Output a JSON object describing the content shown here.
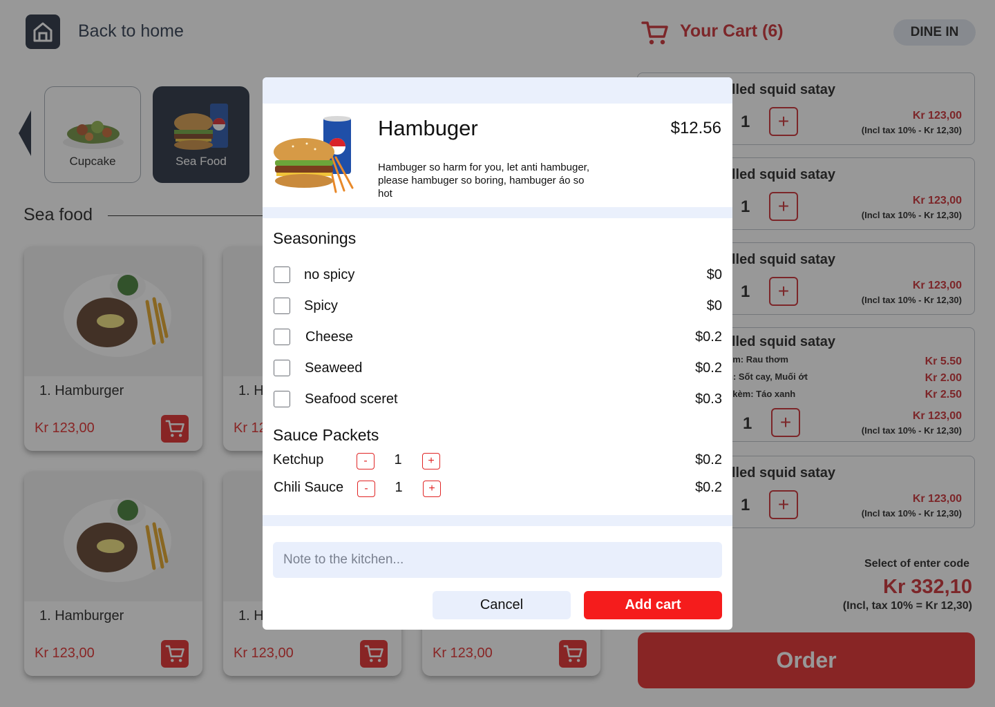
{
  "header": {
    "back_label": "Back to home",
    "cart_title": "Your Cart (6)",
    "dine_mode": "DINE IN"
  },
  "categories": [
    {
      "label": "Cupcake"
    },
    {
      "label": "Sea Food"
    }
  ],
  "section": {
    "title": "Sea food"
  },
  "products": [
    {
      "name": "1. Hamburger",
      "price": "Kr 123,00"
    },
    {
      "name": "1. H",
      "price": "Kr 12"
    },
    {
      "name": "1. Hamburger",
      "price": "Kr 123,00"
    },
    {
      "name": "1. H",
      "price": "Kr 123,00"
    },
    {
      "price": "Kr 123,00"
    }
  ],
  "cart_lines": [
    {
      "name": "lled squid satay",
      "qty": "1",
      "price": "Kr 123,00",
      "tax": "(Incl tax 10% - Kr 12,30)"
    },
    {
      "name": "lled squid satay",
      "qty": "1",
      "price": "Kr 123,00",
      "tax": "(Incl tax 10% - Kr 12,30)"
    },
    {
      "name": "lled squid satay",
      "qty": "1",
      "price": "Kr 123,00",
      "tax": "(Incl tax 10% - Kr 12,30)"
    },
    {
      "name": "lled squid satay",
      "qty": "1",
      "price": "Kr 123,00",
      "tax": "(Incl tax 10% - Kr 12,30)",
      "options": [
        {
          "text": "èm: Rau thơm",
          "price": "Kr 5.50"
        },
        {
          "text": "n: Sốt cay, Muối ớt",
          "price": "Kr 2.00"
        },
        {
          "text": "ı kèm: Táo xanh",
          "price": "Kr 2.50"
        }
      ]
    },
    {
      "name": "lled squid satay",
      "qty": "1",
      "price": "Kr 123,00",
      "tax": "(Incl tax 10% - Kr 12,30)"
    }
  ],
  "summary": {
    "code_label": "Select of enter code",
    "total": "Kr 332,10",
    "tax": "(Incl, tax 10% = Kr 12,30)",
    "order_label": "Order"
  },
  "modal": {
    "title": "Hambuger",
    "price": "$12.56",
    "description": "Hambuger so harm for you,  let anti hambuger, please hambuger so  boring, hambuger áo so hot",
    "seasonings_title": "Seasonings",
    "seasonings": [
      {
        "label": "no spicy",
        "price": "$0",
        "checked": false
      },
      {
        "label": "Spicy",
        "price": "$0",
        "checked": false
      },
      {
        "label": "Cheese",
        "price": "$0.2",
        "checked": false
      },
      {
        "label": "Seaweed",
        "price": "$0.2",
        "checked": false
      },
      {
        "label": "Seafood sceret",
        "price": "$0.3",
        "checked": false
      }
    ],
    "sauce_title": "Sauce Packets",
    "sauces": [
      {
        "label": "Ketchup",
        "minus": "-",
        "count": "1",
        "plus": "+",
        "price": "$0.2"
      },
      {
        "label": "Chili Sauce",
        "minus": "-",
        "count": "1",
        "plus": "+",
        "price": "$0.2"
      }
    ],
    "note_placeholder": "Note to the kitchen...",
    "cancel_label": "Cancel",
    "add_label": "Add cart"
  },
  "colors": {
    "accent_red": "#e02424",
    "navy": "#1f2a3a",
    "modal_band": "#eaf0fc"
  }
}
